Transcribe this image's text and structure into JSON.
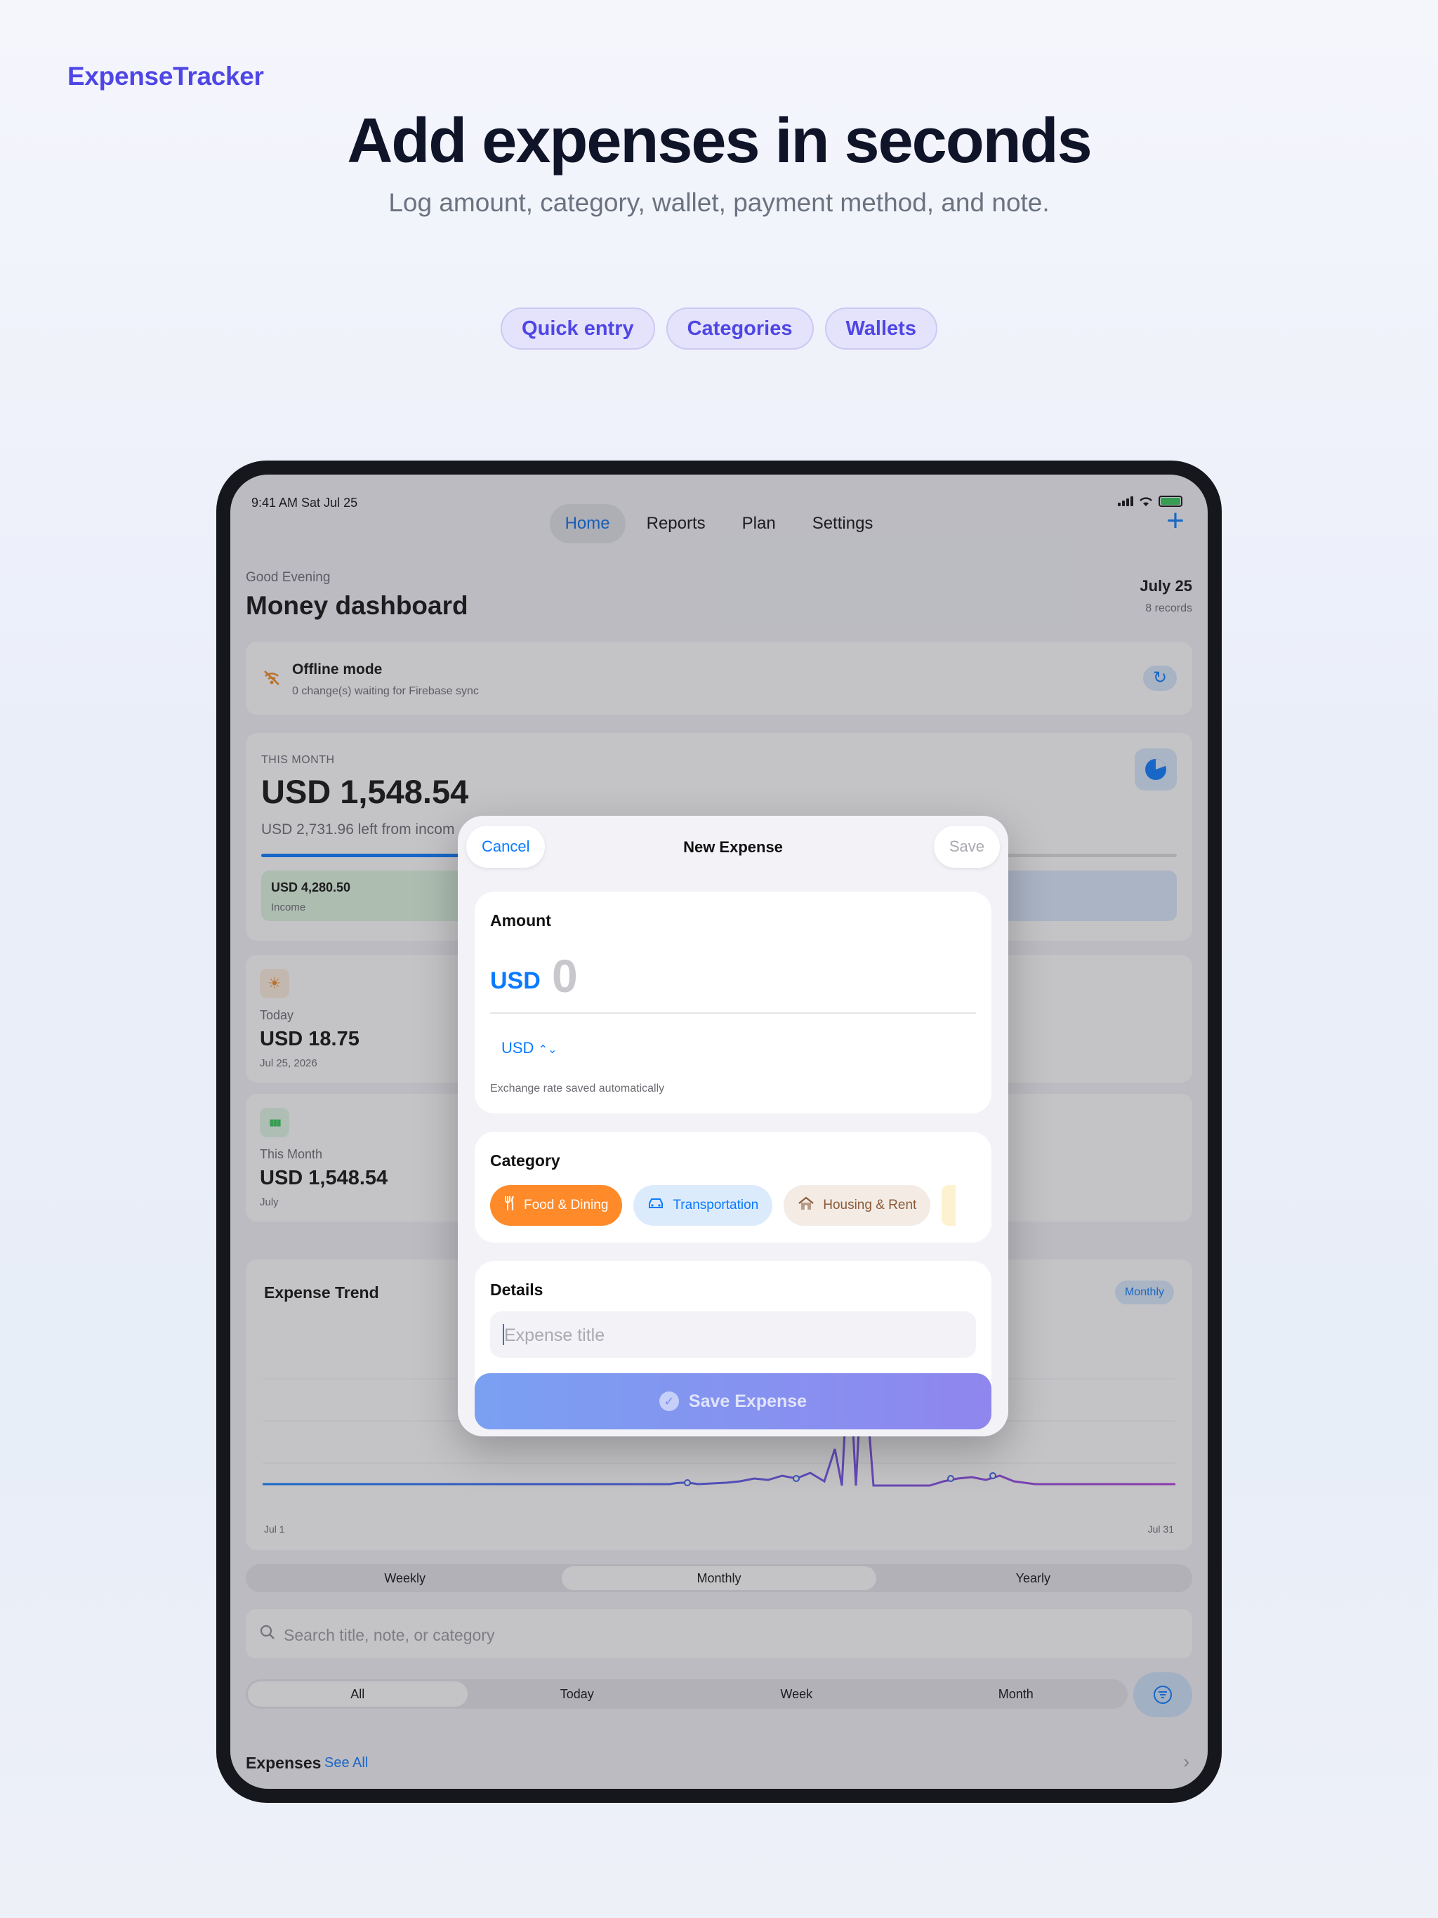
{
  "brand": "ExpenseTracker",
  "headline": "Add expenses in seconds",
  "subline": "Log amount, category, wallet, payment method, and note.",
  "chips": [
    "Quick entry",
    "Categories",
    "Wallets"
  ],
  "status": {
    "time": "9:41 AM   Sat Jul 25"
  },
  "nav": {
    "tabs": [
      "Home",
      "Reports",
      "Plan",
      "Settings"
    ],
    "active": "Home",
    "add_icon": "plus-icon"
  },
  "header": {
    "greeting": "Good Evening",
    "title": "Money dashboard",
    "date": "July 25",
    "records": "8 records"
  },
  "offline": {
    "title": "Offline mode",
    "subtitle": "0 change(s) waiting for Firebase sync"
  },
  "month_card": {
    "label": "THIS MONTH",
    "amount": "USD 1,548.54",
    "left_text": "USD 2,731.96 left from incom",
    "progress": 0.36,
    "income_value": "USD 4,280.50",
    "income_label": "Income"
  },
  "stats": [
    {
      "label": "Today",
      "value": "USD 18.75",
      "sub": "Jul 25, 2026",
      "icon": "sun-icon",
      "color": "#f08a24"
    },
    {
      "label": "This Month",
      "value": "USD 1,548.54",
      "sub": "July",
      "icon": "bar-chart-icon",
      "color": "#34c759"
    }
  ],
  "trend": {
    "title": "Expense Trend",
    "badge": "Monthly",
    "x_start": "Jul 1",
    "x_end": "Jul 31"
  },
  "period_segments": [
    "Weekly",
    "Monthly",
    "Yearly"
  ],
  "period_active": "Monthly",
  "search": {
    "placeholder": "Search title, note, or category"
  },
  "filter_segments": [
    "All",
    "Today",
    "Week",
    "Month"
  ],
  "filter_active": "All",
  "expenses": {
    "title": "Expenses",
    "see_all": "See All"
  },
  "modal": {
    "cancel": "Cancel",
    "title": "New Expense",
    "save": "Save",
    "amount_header": "Amount",
    "currency": "USD",
    "amount_value": "0",
    "currency_select": "USD",
    "rate_note": "Exchange rate saved automatically",
    "category_header": "Category",
    "categories": [
      {
        "label": "Food & Dining",
        "icon": "fork-knife-icon"
      },
      {
        "label": "Transportation",
        "icon": "car-icon"
      },
      {
        "label": "Housing & Rent",
        "icon": "house-icon"
      }
    ],
    "details_header": "Details",
    "title_placeholder": "Expense title",
    "save_button": "Save Expense"
  },
  "colors": {
    "accent": "#0a7aff",
    "brand": "#4f46e5",
    "food": "#ff8a2a"
  }
}
